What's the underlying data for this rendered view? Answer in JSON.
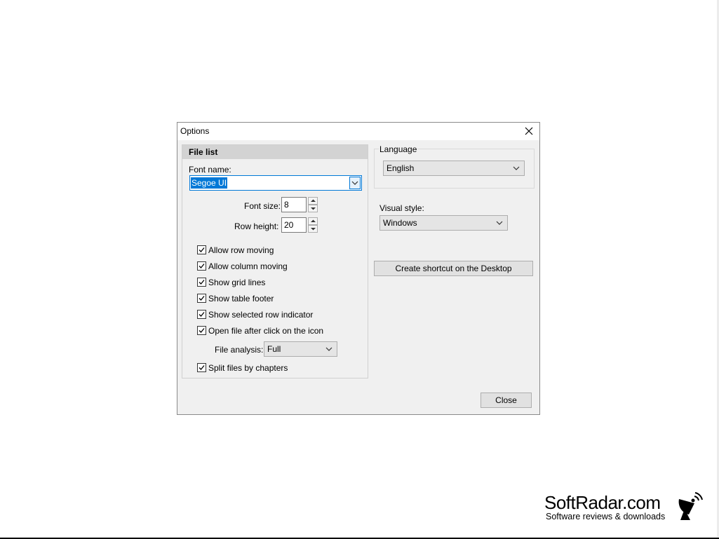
{
  "dialog": {
    "title": "Options",
    "file_list": {
      "header": "File list",
      "font_name_label": "Font name:",
      "font_name_value": "Segoe UI",
      "font_size_label": "Font size:",
      "font_size_value": "8",
      "row_height_label": "Row height:",
      "row_height_value": "20",
      "checkboxes": [
        {
          "label": "Allow row moving",
          "checked": true
        },
        {
          "label": "Allow column moving",
          "checked": true
        },
        {
          "label": "Show grid lines",
          "checked": true
        },
        {
          "label": "Show table footer",
          "checked": true
        },
        {
          "label": "Show selected row indicator",
          "checked": true
        },
        {
          "label": "Open file after click on the icon",
          "checked": true
        },
        {
          "label": "Split files by chapters",
          "checked": true
        }
      ],
      "file_analysis_label": "File analysis:",
      "file_analysis_value": "Full"
    },
    "language": {
      "caption": "Language",
      "value": "English"
    },
    "visual_style": {
      "label": "Visual style:",
      "value": "Windows"
    },
    "shortcut_button": "Create shortcut on the Desktop",
    "close_button": "Close"
  },
  "watermark": {
    "title": "SoftRadar.com",
    "subtitle": "Software reviews & downloads",
    "icon": "satellite-dish-icon"
  },
  "colors": {
    "accent": "#0078d7",
    "dialog_bg": "#f0f0f0",
    "group_header_bg": "#d3d3d3"
  }
}
